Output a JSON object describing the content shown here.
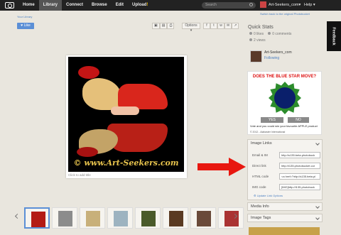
{
  "nav": {
    "items": [
      "Home",
      "Library",
      "Connect",
      "Browse",
      "Edit",
      "Upload"
    ],
    "upload_mark": "!",
    "search_placeholder": "Search",
    "username": "Art-Seekers_com",
    "help": "Help"
  },
  "links": {
    "switch": "Switch back to the original Photobucket",
    "your_library": "Your Library"
  },
  "toolbar": {
    "like": "Like",
    "options": "Options",
    "share_icons": [
      "facebook-icon",
      "twitter-icon",
      "vk-icon",
      "email-icon",
      "share-icon"
    ]
  },
  "photo": {
    "watermark": "© www.Art-Seekers.com",
    "add_title": "Click to add title"
  },
  "quick_stats": {
    "title": "Quick Stats",
    "likes": "0 likes",
    "comments": "0 comments",
    "views": "2 views"
  },
  "owner": {
    "name": "Art-Seekers_com",
    "status": "Following"
  },
  "ad": {
    "headline": "DOES  THE  BLUE STAR MOVE?",
    "yes": "YES",
    "no": "NO",
    "text": "Vote and you could win your favourite APPLE product",
    "copyright": "© 2012 - Alabaster International"
  },
  "image_links": {
    "title": "Image Links",
    "rows": [
      {
        "label": "Email & IM",
        "value": "http://s135.beta.photobuck"
      },
      {
        "label": "Direct link",
        "value": "http://i135.photobucket.cor"
      },
      {
        "label": "HTML code",
        "value": "<a href=\"http://s135.beta.pl"
      },
      {
        "label": "IMG code",
        "value": "[IMG]http://i135.photobuck"
      }
    ],
    "update": "Update Link Options"
  },
  "media_info": {
    "title": "Media Info"
  },
  "image_tags": {
    "title": "Image Tags"
  },
  "feedback": "Feedback",
  "filmstrip_count": 8
}
